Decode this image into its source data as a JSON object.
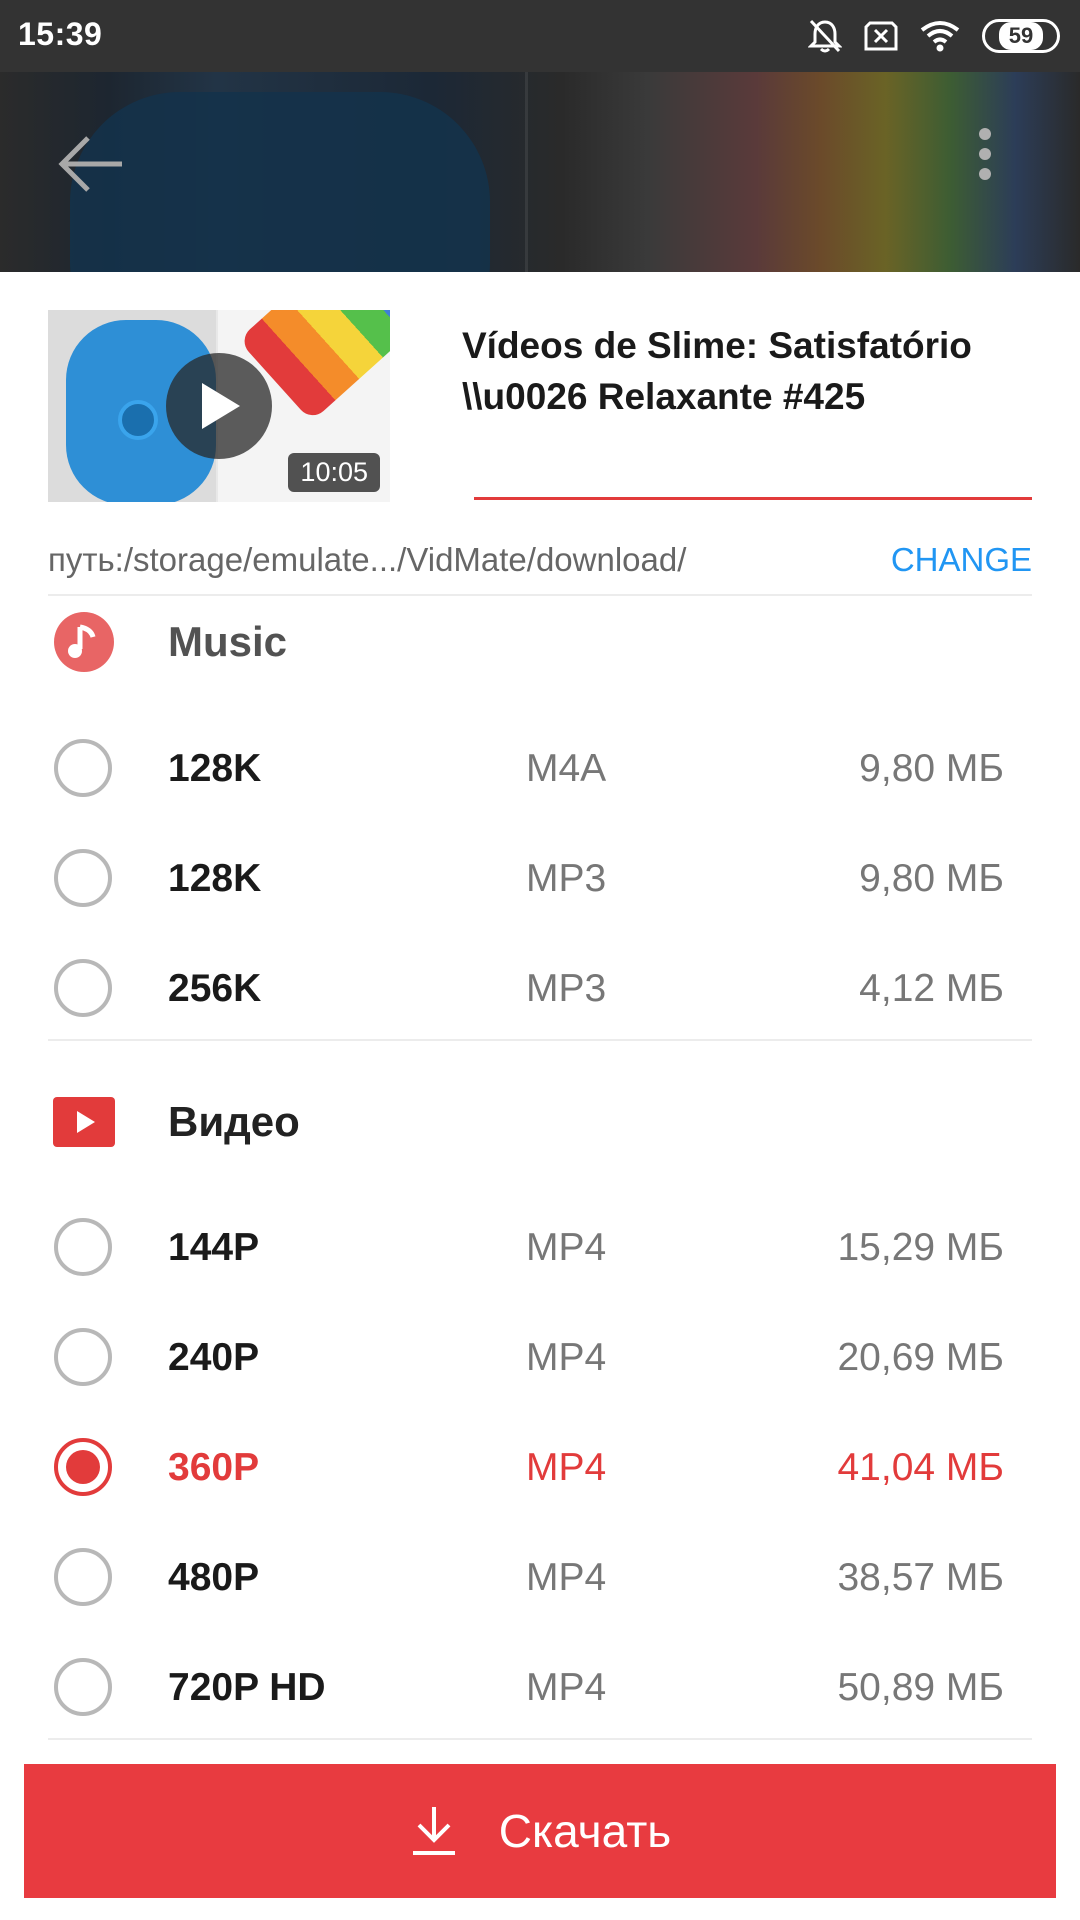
{
  "status_bar": {
    "time": "15:39",
    "battery": "59",
    "icons": [
      "bell-off-icon",
      "sim-off-icon",
      "wifi-icon",
      "battery-icon"
    ]
  },
  "header": {
    "back_icon": "arrow-left-icon",
    "menu_icon": "more-vertical-icon"
  },
  "video": {
    "title": "Vídeos de Slime: Satisfatório \\\\u0026 Relaxante #425",
    "duration": "10:05"
  },
  "path": {
    "text": "путь:/storage/emulate.../VidMate/download/",
    "change_label": "CHANGE"
  },
  "music": {
    "title": "Music",
    "options": [
      {
        "quality": "128K",
        "format": "M4A",
        "size": "9,80 МБ",
        "selected": false
      },
      {
        "quality": "128K",
        "format": "MP3",
        "size": "9,80 МБ",
        "selected": false
      },
      {
        "quality": "256K",
        "format": "MP3",
        "size": "4,12 МБ",
        "selected": false
      }
    ]
  },
  "video_section": {
    "title": "Видео",
    "options": [
      {
        "quality": "144P",
        "format": "MP4",
        "size": "15,29 МБ",
        "selected": false
      },
      {
        "quality": "240P",
        "format": "MP4",
        "size": "20,69 МБ",
        "selected": false
      },
      {
        "quality": "360P",
        "format": "MP4",
        "size": "41,04 МБ",
        "selected": true
      },
      {
        "quality": "480P",
        "format": "MP4",
        "size": "38,57 МБ",
        "selected": false
      },
      {
        "quality": "720P HD",
        "format": "MP4",
        "size": "50,89 МБ",
        "selected": false
      }
    ]
  },
  "download": {
    "label": "Скачать",
    "icon": "download-icon"
  },
  "colors": {
    "accent": "#e23b3b",
    "link": "#2196f3",
    "status_bar": "#333333"
  }
}
